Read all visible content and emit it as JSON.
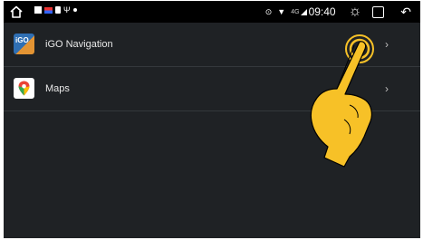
{
  "status_bar": {
    "time": "09:40",
    "network": "4G",
    "icons": [
      "home-icon",
      "location-icon",
      "wifi-icon",
      "signal-icon",
      "brightness-icon",
      "recent-apps-icon",
      "back-icon"
    ]
  },
  "apps": [
    {
      "label": "iGO Navigation",
      "icon": "igo-navigation-icon",
      "icon_text": "iGO"
    },
    {
      "label": "Maps",
      "icon": "google-maps-icon"
    }
  ],
  "overlay": {
    "icon": "tap-gesture-hand-icon",
    "color": "#f7c127"
  },
  "colors": {
    "background": "#1f2225",
    "status_bar": "#000000",
    "divider": "#34383c"
  }
}
